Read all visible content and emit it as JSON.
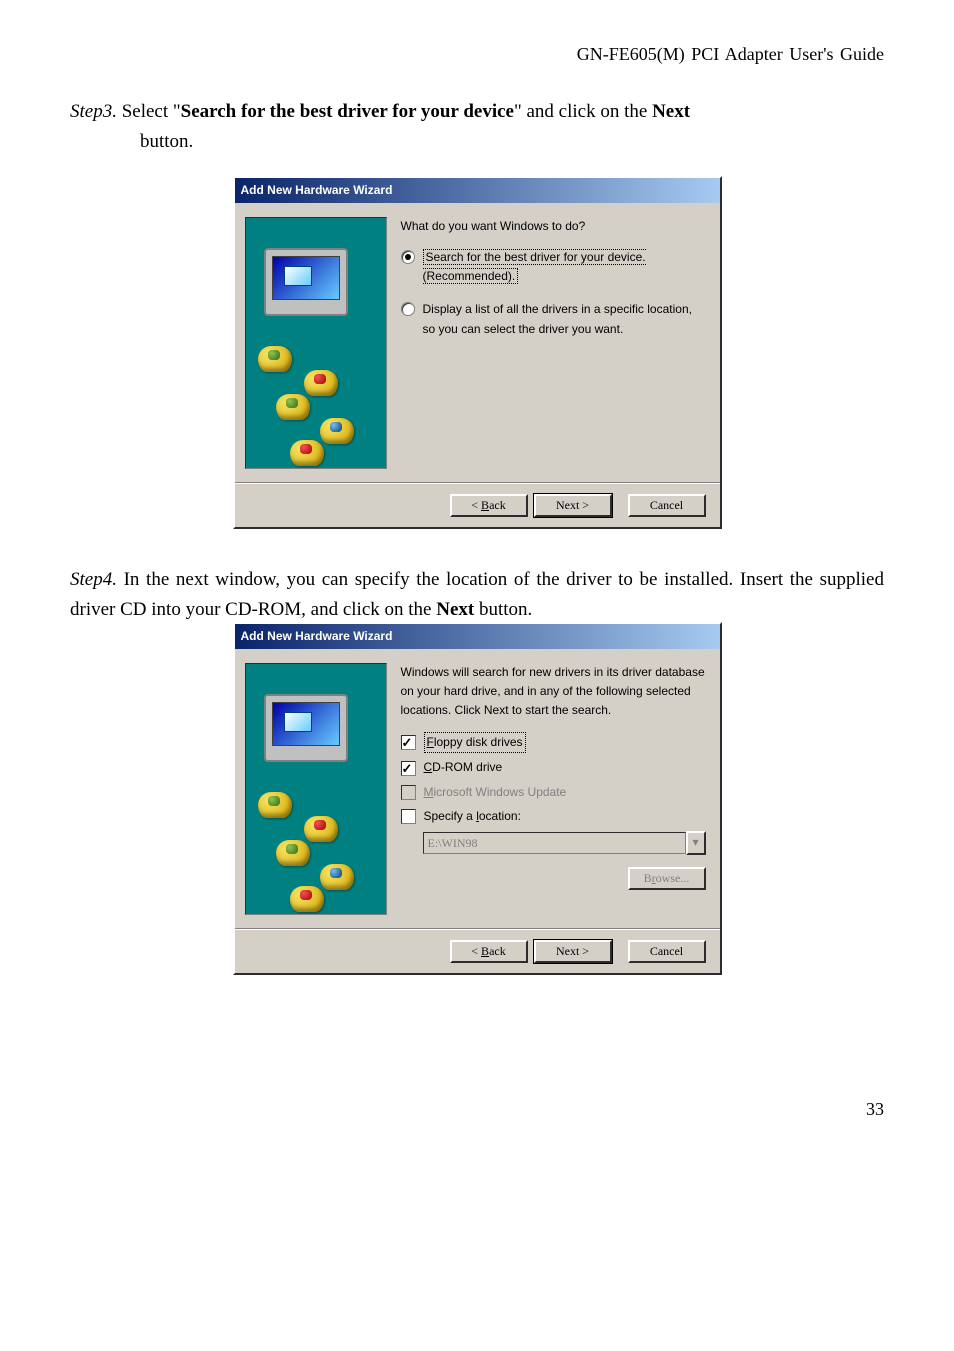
{
  "header": "GN-FE605(M)  PCI  Adapter  User's  Guide",
  "step3": {
    "label": "Step3.",
    "line_a": " Select \"",
    "bold_a": "Search for the best driver for your device",
    "line_b": "\" and click on the ",
    "bold_b": "Next",
    "line_c": " button."
  },
  "step4": {
    "label": "Step4.",
    "body_a": " In the next window, you can specify the location of the driver to be installed. Insert the supplied driver CD into your CD-ROM, and click on the ",
    "bold_a": "Next",
    "body_b": " button."
  },
  "dlg1": {
    "title": "Add New Hardware Wizard",
    "question": "What do you want Windows to do?",
    "opt1": "Search for the best driver for your device. (Recommended).",
    "opt2": "Display a list of all the drivers in a specific location, so you can select the driver you want.",
    "back": "< Back",
    "next": "Next >",
    "cancel": "Cancel"
  },
  "dlg2": {
    "title": "Add New Hardware Wizard",
    "intro": "Windows will search for new drivers in its driver database on your hard drive, and in any of the following selected locations. Click Next to start the search.",
    "c_floppy": "Floppy disk drives",
    "c_cd": "CD-ROM drive",
    "c_msupd": "Microsoft Windows Update",
    "c_specify": "Specify a location:",
    "path": "E:\\WIN98",
    "browse": "Browse...",
    "back": "< Back",
    "next": "Next >",
    "cancel": "Cancel"
  },
  "page": "33"
}
